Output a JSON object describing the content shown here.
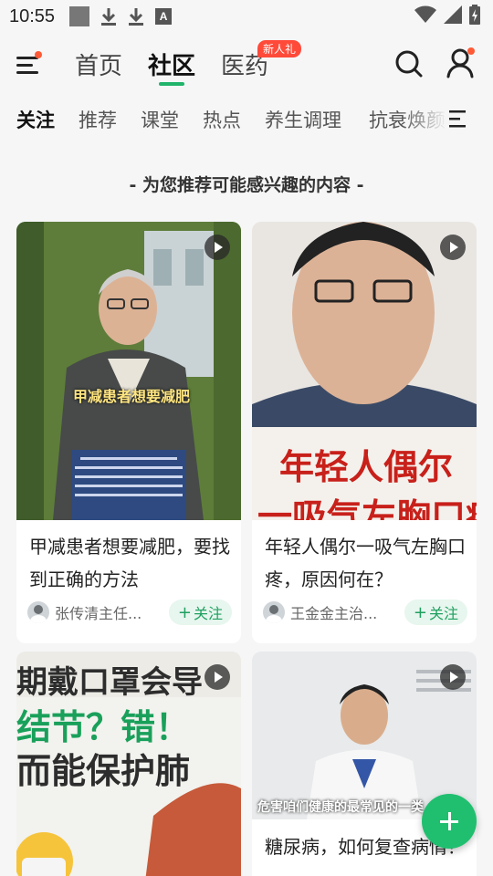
{
  "status_bar": {
    "time": "10:55",
    "icons": [
      "image-icon",
      "download-icon",
      "download-icon",
      "a-icon",
      "wifi-icon",
      "signal-icon",
      "battery-icon"
    ]
  },
  "top_nav": {
    "tabs": [
      {
        "label": "首页",
        "active": false
      },
      {
        "label": "社区",
        "active": true
      },
      {
        "label": "医药",
        "active": false
      }
    ],
    "new_badge": "新人礼",
    "accent_color": "#20b46a",
    "badge_color": "#ff4a3a"
  },
  "categories": {
    "items": [
      "关注",
      "推荐",
      "课堂",
      "热点",
      "养生调理",
      "抗衰焕颜"
    ],
    "active_index": 0
  },
  "recommend_title": "- 为您推荐可能感兴趣的内容 -",
  "cards": [
    {
      "title": "甲减患者想要减肥，要找到正确的方法",
      "author": "张传清主任...",
      "follow_label": "关注",
      "overlay_caption": "甲减患者想要减肥",
      "is_video": true
    },
    {
      "title": "年轻人偶尔一吸气左胸口疼，原因何在？",
      "author": "王金金主治...",
      "follow_label": "关注",
      "overlay_line1": "年轻人偶尔",
      "overlay_line2": "一吸气左胸口疼",
      "is_video": true
    },
    {
      "title": "",
      "overlay_line1": "期戴口罩会导",
      "overlay_line2": "结节？错！",
      "overlay_line3": "而能保护肺",
      "is_video": true
    },
    {
      "title": "糖尿病，如何复查病情？",
      "overlay_caption": "危害咱们健康的最常见的一类",
      "is_video": true
    }
  ],
  "fab": {
    "icon": "plus-icon",
    "color": "#1fbf6f"
  }
}
